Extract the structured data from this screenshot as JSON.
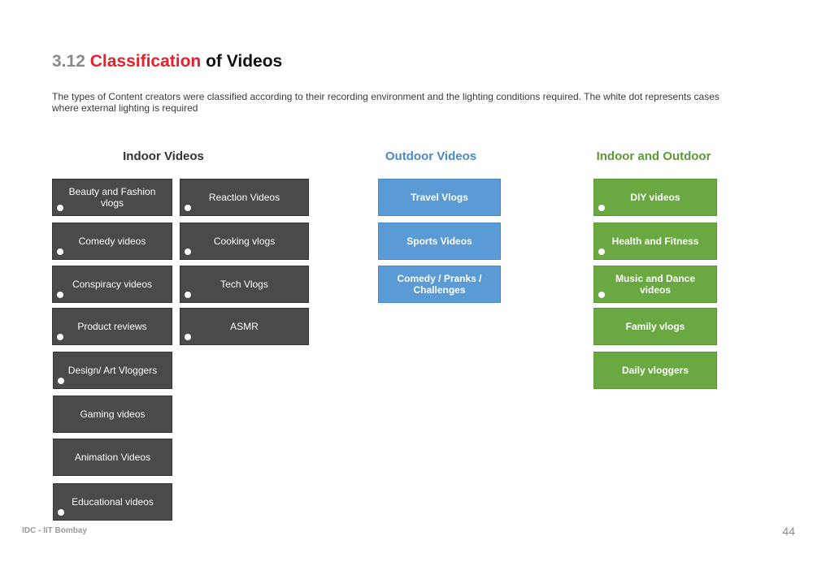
{
  "header": {
    "section_number": "3.12",
    "title_accent": "Classification",
    "title_rest": "of Videos"
  },
  "description": "The types of Content creators were classified according to their recording environment and the lighting conditions required. The white dot represents cases where external lighting is required",
  "columns": {
    "indoor": {
      "heading": "Indoor Videos",
      "items": [
        {
          "label": "Beauty and Fashion vlogs",
          "external_lighting": true
        },
        {
          "label": "Comedy videos",
          "external_lighting": true
        },
        {
          "label": "Conspiracy videos",
          "external_lighting": true
        },
        {
          "label": "Product reviews",
          "external_lighting": true
        },
        {
          "label": "Design/ Art Vloggers",
          "external_lighting": true
        },
        {
          "label": "Gaming videos",
          "external_lighting": false
        },
        {
          "label": "Animation Videos",
          "external_lighting": false
        },
        {
          "label": "Educational videos",
          "external_lighting": true
        },
        {
          "label": "Reaction Videos",
          "external_lighting": true
        },
        {
          "label": "Cooking vlogs",
          "external_lighting": true
        },
        {
          "label": "Tech Vlogs",
          "external_lighting": true
        },
        {
          "label": "ASMR",
          "external_lighting": true
        }
      ]
    },
    "outdoor": {
      "heading": "Outdoor Videos",
      "items": [
        {
          "label": "Travel Vlogs",
          "external_lighting": false
        },
        {
          "label": "Sports Videos",
          "external_lighting": false
        },
        {
          "label": "Comedy / Pranks / Challenges",
          "external_lighting": false
        }
      ]
    },
    "both": {
      "heading": "Indoor and Outdoor",
      "items": [
        {
          "label": "DIY videos",
          "external_lighting": true
        },
        {
          "label": "Health and Fitness",
          "external_lighting": true
        },
        {
          "label": "Music and Dance videos",
          "external_lighting": true
        },
        {
          "label": "Family vlogs",
          "external_lighting": false
        },
        {
          "label": "Daily vloggers",
          "external_lighting": false
        }
      ]
    }
  },
  "colors": {
    "accent_red": "#e8202a",
    "indoor_box": "#4a4a4a",
    "outdoor_box": "#5b9bd5",
    "both_box": "#6aa842",
    "outdoor_heading": "#4a8ac4",
    "both_heading": "#5a9a36"
  },
  "footer": {
    "institution": "IDC - IIT Bombay",
    "page_number": "44"
  }
}
